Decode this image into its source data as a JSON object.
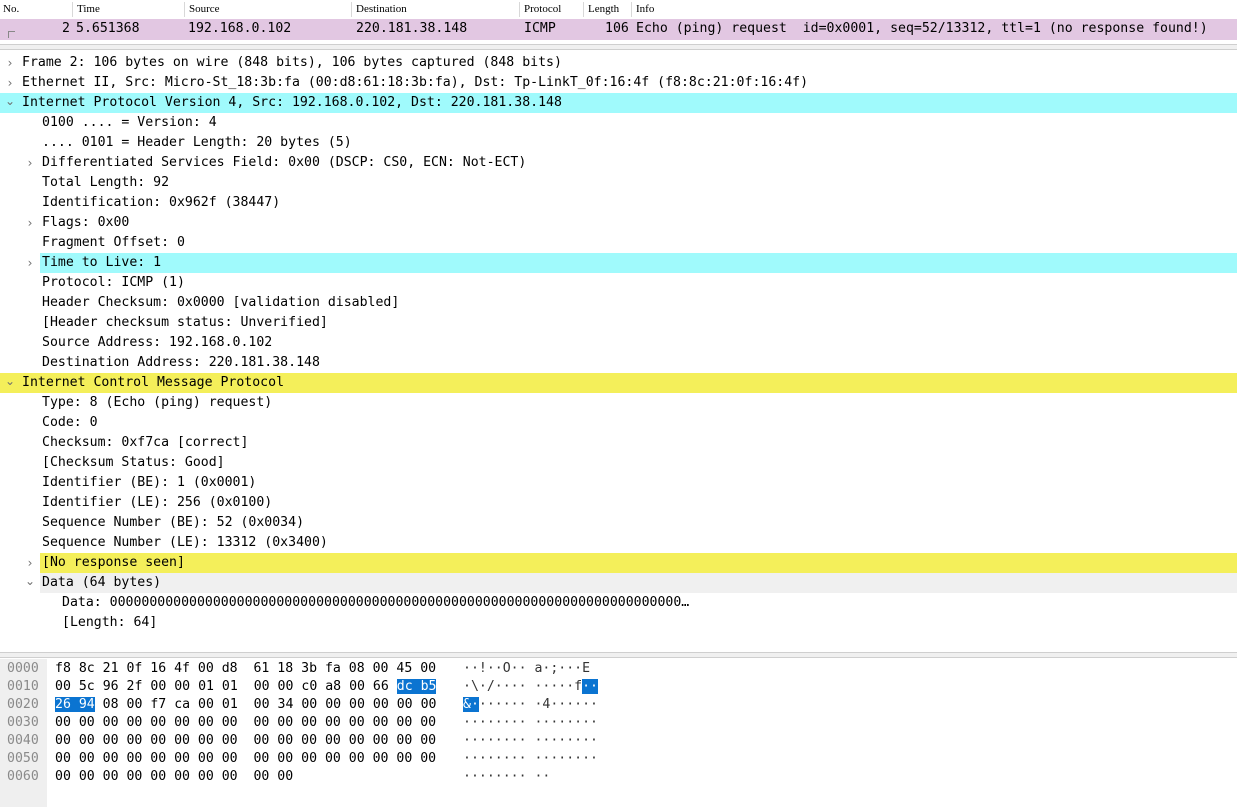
{
  "packet_list": {
    "columns": [
      "No.",
      "Time",
      "Source",
      "Destination",
      "Protocol",
      "Length",
      "Info"
    ],
    "row": {
      "no": "2",
      "time": "5.651368",
      "source": "192.168.0.102",
      "destination": "220.181.38.148",
      "protocol": "ICMP",
      "length": "106",
      "info": "Echo (ping) request  id=0x0001, seq=52/13312, ttl=1 (no response found!)"
    }
  },
  "tree": [
    {
      "text": "Frame 2: 106 bytes on wire (848 bits), 106 bytes captured (848 bits)",
      "level": 0,
      "arrow": "collapsed",
      "highlight": "none"
    },
    {
      "text": "Ethernet II, Src: Micro-St_18:3b:fa (00:d8:61:18:3b:fa), Dst: Tp-LinkT_0f:16:4f (f8:8c:21:0f:16:4f)",
      "level": 0,
      "arrow": "collapsed",
      "highlight": "none"
    },
    {
      "text": "Internet Protocol Version 4, Src: 192.168.0.102, Dst: 220.181.38.148",
      "level": 0,
      "arrow": "expanded",
      "highlight": "cyan"
    },
    {
      "text": "0100 .... = Version: 4",
      "level": 1,
      "arrow": "none",
      "highlight": "none"
    },
    {
      "text": ".... 0101 = Header Length: 20 bytes (5)",
      "level": 1,
      "arrow": "none",
      "highlight": "none"
    },
    {
      "text": "Differentiated Services Field: 0x00 (DSCP: CS0, ECN: Not-ECT)",
      "level": 1,
      "arrow": "collapsed",
      "highlight": "none"
    },
    {
      "text": "Total Length: 92",
      "level": 1,
      "arrow": "none",
      "highlight": "none"
    },
    {
      "text": "Identification: 0x962f (38447)",
      "level": 1,
      "arrow": "none",
      "highlight": "none"
    },
    {
      "text": "Flags: 0x00",
      "level": 1,
      "arrow": "collapsed",
      "highlight": "none"
    },
    {
      "text": "Fragment Offset: 0",
      "level": 1,
      "arrow": "none",
      "highlight": "none"
    },
    {
      "text": "Time to Live: 1",
      "level": 1,
      "arrow": "collapsed",
      "highlight": "cyan"
    },
    {
      "text": "Protocol: ICMP (1)",
      "level": 1,
      "arrow": "none",
      "highlight": "none"
    },
    {
      "text": "Header Checksum: 0x0000 [validation disabled]",
      "level": 1,
      "arrow": "none",
      "highlight": "none"
    },
    {
      "text": "[Header checksum status: Unverified]",
      "level": 1,
      "arrow": "none",
      "highlight": "none"
    },
    {
      "text": "Source Address: 192.168.0.102",
      "level": 1,
      "arrow": "none",
      "highlight": "none"
    },
    {
      "text": "Destination Address: 220.181.38.148",
      "level": 1,
      "arrow": "none",
      "highlight": "none"
    },
    {
      "text": "Internet Control Message Protocol",
      "level": 0,
      "arrow": "expanded",
      "highlight": "yellow"
    },
    {
      "text": "Type: 8 (Echo (ping) request)",
      "level": 1,
      "arrow": "none",
      "highlight": "none"
    },
    {
      "text": "Code: 0",
      "level": 1,
      "arrow": "none",
      "highlight": "none"
    },
    {
      "text": "Checksum: 0xf7ca [correct]",
      "level": 1,
      "arrow": "none",
      "highlight": "none"
    },
    {
      "text": "[Checksum Status: Good]",
      "level": 1,
      "arrow": "none",
      "highlight": "none"
    },
    {
      "text": "Identifier (BE): 1 (0x0001)",
      "level": 1,
      "arrow": "none",
      "highlight": "none"
    },
    {
      "text": "Identifier (LE): 256 (0x0100)",
      "level": 1,
      "arrow": "none",
      "highlight": "none"
    },
    {
      "text": "Sequence Number (BE): 52 (0x0034)",
      "level": 1,
      "arrow": "none",
      "highlight": "none"
    },
    {
      "text": "Sequence Number (LE): 13312 (0x3400)",
      "level": 1,
      "arrow": "none",
      "highlight": "none"
    },
    {
      "text": "[No response seen]",
      "level": 1,
      "arrow": "collapsed",
      "highlight": "yellow"
    },
    {
      "text": "Data (64 bytes)",
      "level": 1,
      "arrow": "expanded",
      "highlight": "grey"
    },
    {
      "text": "Data: 000000000000000000000000000000000000000000000000000000000000000000000000…",
      "level": 2,
      "arrow": "none",
      "highlight": "none"
    },
    {
      "text": "[Length: 64]",
      "level": 2,
      "arrow": "none",
      "highlight": "none"
    }
  ],
  "bytes": [
    {
      "offset": "0000",
      "hex": "f8 8c 21 0f 16 4f 00 d8  61 18 3b fa 08 00 45 00",
      "ascii": "··!··O·· a·;···E",
      "sel_hex": [],
      "sel_ascii": []
    },
    {
      "offset": "0010",
      "hex": "00 5c 96 2f 00 00 01 01  00 00 c0 a8 00 66 dc b5",
      "ascii": "·\\·/···· ·····f··",
      "sel_hex": [
        14,
        15
      ],
      "sel_ascii": [
        15,
        16
      ]
    },
    {
      "offset": "0020",
      "hex": "26 94 08 00 f7 ca 00 01  00 34 00 00 00 00 00 00",
      "ascii": "&······· ·4······",
      "sel_hex": [
        0,
        1
      ],
      "sel_ascii": [
        0,
        1
      ]
    },
    {
      "offset": "0030",
      "hex": "00 00 00 00 00 00 00 00  00 00 00 00 00 00 00 00",
      "ascii": "········ ········",
      "sel_hex": [],
      "sel_ascii": []
    },
    {
      "offset": "0040",
      "hex": "00 00 00 00 00 00 00 00  00 00 00 00 00 00 00 00",
      "ascii": "········ ········",
      "sel_hex": [],
      "sel_ascii": []
    },
    {
      "offset": "0050",
      "hex": "00 00 00 00 00 00 00 00  00 00 00 00 00 00 00 00",
      "ascii": "········ ········",
      "sel_hex": [],
      "sel_ascii": []
    },
    {
      "offset": "0060",
      "hex": "00 00 00 00 00 00 00 00  00 00",
      "ascii": "········ ··",
      "sel_hex": [],
      "sel_ascii": []
    }
  ],
  "colors": {
    "row_selected": "#e2c7e2",
    "highlight_cyan": "#a0fafc",
    "highlight_yellow": "#f4ef5a",
    "byte_selection": "#0b74d1"
  }
}
